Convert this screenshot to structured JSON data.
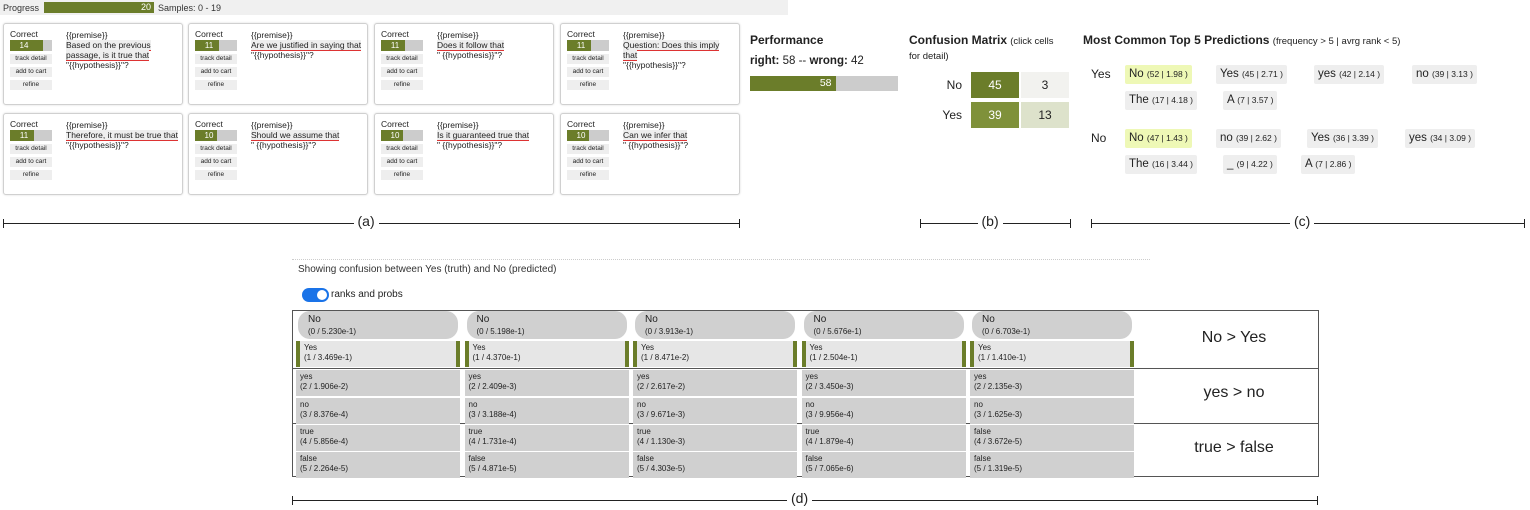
{
  "progress": {
    "label": "Progress",
    "value": "20",
    "samples": "Samples: 0 - 19"
  },
  "cards": [
    {
      "correct": "Correct",
      "count": "14",
      "frac": 0.78,
      "premise": "{{premise}}",
      "prompt": "Based on the previous passage, is it true that",
      "hypo": "\"{{hypothesis}}\"?",
      "track": "track detail",
      "cart": "add to cart",
      "refine": "refine"
    },
    {
      "correct": "Correct",
      "count": "11",
      "frac": 0.58,
      "premise": "{{premise}}",
      "prompt": "Are we justified in saying that",
      "hypo": "\"{{hypothesis}}\"?",
      "track": "track detail",
      "cart": "add to cart",
      "refine": "refine"
    },
    {
      "correct": "Correct",
      "count": "11",
      "frac": 0.58,
      "premise": "{{premise}}",
      "prompt": "Does it follow that",
      "hypo": "\" {{hypothesis}}\"?",
      "track": "track detail",
      "cart": "add to cart",
      "refine": "refine"
    },
    {
      "correct": "Correct",
      "count": "11",
      "frac": 0.58,
      "premise": "{{premise}}",
      "prompt": "Question: Does this imply that",
      "hypo": "\"{{hypothesis}}\"?",
      "track": "track detail",
      "cart": "add to cart",
      "refine": "refine"
    },
    {
      "correct": "Correct",
      "count": "11",
      "frac": 0.58,
      "premise": "{{premise}}",
      "prompt": "Therefore, it must be true that",
      "hypo": "\"{{hypothesis}}\"?",
      "track": "track detail",
      "cart": "add to cart",
      "refine": "refine"
    },
    {
      "correct": "Correct",
      "count": "10",
      "frac": 0.52,
      "premise": "{{premise}}",
      "prompt": "Should we assume that",
      "hypo": "\" {{hypothesis}}\"?",
      "track": "track detail",
      "cart": "add to cart",
      "refine": "refine"
    },
    {
      "correct": "Correct",
      "count": "10",
      "frac": 0.52,
      "premise": "{{premise}}",
      "prompt": "Is it guaranteed true that",
      "hypo": "\" {{hypothesis}}\"?",
      "track": "track detail",
      "cart": "add to cart",
      "refine": "refine"
    },
    {
      "correct": "Correct",
      "count": "10",
      "frac": 0.52,
      "premise": "{{premise}}",
      "prompt": "Can we infer that",
      "hypo": "\" {{hypothesis}}\"?",
      "track": "track detail",
      "cart": "add to cart",
      "refine": "refine"
    }
  ],
  "performance": {
    "title": "Performance",
    "right_label": "right:",
    "right": "58",
    "sep": "--",
    "wrong_label": "wrong:",
    "wrong": "42",
    "bar_value": "58",
    "fraction": 0.58
  },
  "confusion": {
    "title": "Confusion Matrix",
    "hint": "(click cells for detail)",
    "rows": [
      {
        "label": "No",
        "cells": [
          {
            "value": "45",
            "color": "#6b7d2a"
          },
          {
            "value": "3",
            "color": "#f2f2ef"
          }
        ]
      },
      {
        "label": "Yes",
        "cells": [
          {
            "value": "39",
            "color": "#7f913a"
          },
          {
            "value": "13",
            "color": "#dde2cb"
          }
        ]
      }
    ]
  },
  "predictions": {
    "title": "Most Common Top 5 Predictions",
    "hint": "(frequency > 5 | avrg rank < 5)",
    "rows": [
      {
        "label": "Yes",
        "chips": [
          {
            "word": "No",
            "stat": "(52 | 1.98 )",
            "hl": true
          },
          {
            "word": "Yes",
            "stat": "(45 | 2.71 )"
          },
          {
            "word": "yes",
            "stat": "(42 | 2.14 )"
          },
          {
            "word": "no",
            "stat": "(39 | 3.13 )"
          },
          {
            "word": "The",
            "stat": "(17 | 4.18 )"
          },
          {
            "word": "A",
            "stat": "(7 | 3.57 )"
          }
        ]
      },
      {
        "label": "No",
        "chips": [
          {
            "word": "No",
            "stat": "(47 | 1.43 )",
            "hl": true
          },
          {
            "word": "no",
            "stat": "(39 | 2.62 )"
          },
          {
            "word": "Yes",
            "stat": "(36 | 3.39 )"
          },
          {
            "word": "yes",
            "stat": "(34 | 3.09 )"
          },
          {
            "word": "The",
            "stat": "(16 | 3.44 )"
          },
          {
            "word": "_",
            "stat": "(9 | 4.22 )"
          },
          {
            "word": "A",
            "stat": "(7 | 2.86 )"
          }
        ]
      }
    ]
  },
  "labels": {
    "a": "(a)",
    "b": "(b)",
    "c": "(c)",
    "d": "(d)"
  },
  "detail": {
    "header": "Showing confusion between Yes (truth) and No (predicted)",
    "toggle_label": "ranks and probs",
    "columns": [
      {
        "top": [
          "No",
          "(0 / 5.230e-1)"
        ],
        "r1": [
          "Yes",
          "(1 / 3.469e-1)"
        ],
        "r2": [
          "yes",
          "(2 / 1.906e-2)"
        ],
        "r3": [
          "no",
          "(3 / 8.376e-4)"
        ],
        "r4": [
          "true",
          "(4 / 5.856e-4)"
        ],
        "r5": [
          "false",
          "(5 / 2.264e-5)"
        ]
      },
      {
        "top": [
          "No",
          "(0 / 5.198e-1)"
        ],
        "r1": [
          "Yes",
          "(1 / 4.370e-1)"
        ],
        "r2": [
          "yes",
          "(2 / 2.409e-3)"
        ],
        "r3": [
          "no",
          "(3 / 3.188e-4)"
        ],
        "r4": [
          "true",
          "(4 / 1.731e-4)"
        ],
        "r5": [
          "false",
          "(5 / 4.871e-5)"
        ]
      },
      {
        "top": [
          "No",
          "(0 / 3.913e-1)"
        ],
        "r1": [
          "Yes",
          "(1 / 8.471e-2)"
        ],
        "r2": [
          "yes",
          "(2 / 2.617e-2)"
        ],
        "r3": [
          "no",
          "(3 / 9.671e-3)"
        ],
        "r4": [
          "true",
          "(4 / 1.130e-3)"
        ],
        "r5": [
          "false",
          "(5 / 4.303e-5)"
        ]
      },
      {
        "top": [
          "No",
          "(0 / 5.676e-1)"
        ],
        "r1": [
          "Yes",
          "(1 / 2.504e-1)"
        ],
        "r2": [
          "yes",
          "(2 / 3.450e-3)"
        ],
        "r3": [
          "no",
          "(3 / 9.956e-4)"
        ],
        "r4": [
          "true",
          "(4 / 1.879e-4)"
        ],
        "r5": [
          "false",
          "(5 / 7.065e-6)"
        ]
      },
      {
        "top": [
          "No",
          "(0 / 6.703e-1)"
        ],
        "r1": [
          "Yes",
          "(1 / 1.410e-1)"
        ],
        "r2": [
          "yes",
          "(2 / 2.135e-3)"
        ],
        "r3": [
          "no",
          "(3 / 1.625e-3)"
        ],
        "r4": [
          "false",
          "(4 / 3.672e-5)"
        ],
        "r5": [
          "false",
          "(5 / 1.319e-5)"
        ]
      }
    ],
    "row_labels": [
      "No > Yes",
      "yes > no",
      "true > false"
    ]
  }
}
